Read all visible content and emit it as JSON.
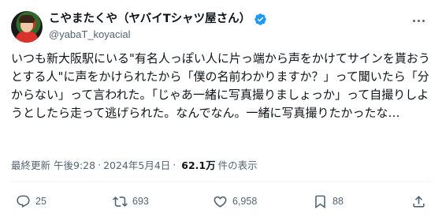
{
  "author": {
    "display_name": "こやまたくや（ヤバイTシャツ屋さん）",
    "handle": "@yabaT_koyacial"
  },
  "tweet": {
    "text": "いつも新大阪駅にいる\"有名人っぽい人に片っ端から声をかけてサインを貰おうとする人\"に声をかけられたから「僕の名前わかりますか？」って聞いたら「分からない」って言われた。「じゃあ一緒に写真撮りましょっか」って自撮りしようとしたら走って逃げられた。なんでなん。一緒に写真撮りたかったな…"
  },
  "meta": {
    "edited": "最終更新",
    "time": "午後9:28",
    "dot": "·",
    "date": "2024年5月4日",
    "views_count": "62.1万",
    "views_label": "件の表示"
  },
  "actions": {
    "reply_count": "25",
    "retweet_count": "693",
    "like_count": "6,958",
    "bookmark_count": "88"
  },
  "icons": {
    "verified": "verified-badge-icon",
    "more": "more-icon",
    "reply": "reply-icon",
    "retweet": "retweet-icon",
    "like": "heart-icon",
    "bookmark": "bookmark-icon",
    "share": "share-icon"
  },
  "colors": {
    "verified": "#1d9bf0",
    "text": "#0f1419",
    "secondary": "#536471"
  }
}
